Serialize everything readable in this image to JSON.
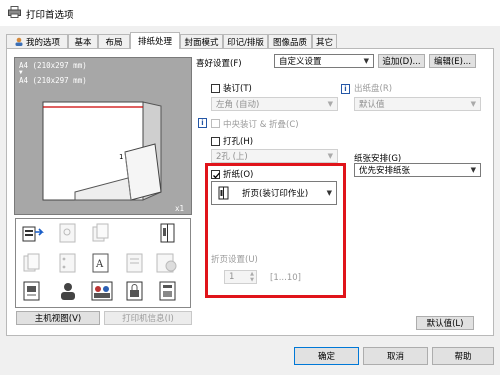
{
  "window": {
    "title": "打印首选项"
  },
  "tabs": [
    {
      "label": "我的选项"
    },
    {
      "label": "基本"
    },
    {
      "label": "布局"
    },
    {
      "label": "排纸处理"
    },
    {
      "label": "封面模式"
    },
    {
      "label": "印记/排版"
    },
    {
      "label": "图像品质"
    },
    {
      "label": "其它"
    }
  ],
  "preview": {
    "paper_line1": "A4 (210x297 mm)",
    "paper_line2": "A4 (210x297 mm)",
    "copies": "x1",
    "page_number": "1"
  },
  "view_buttons": {
    "main_view": "主机视图(V)",
    "printer_info": "打印机信息(I)"
  },
  "favorites": {
    "label": "喜好设置(F)",
    "value": "自定义设置",
    "add": "追加(D)...",
    "edit": "编辑(E)..."
  },
  "staple": {
    "label": "装订(T)",
    "checked": false,
    "value": "左角 (自动)"
  },
  "center_staple": {
    "label": "中央装订 & 折叠(C)",
    "checked": false
  },
  "punch": {
    "label": "打孔(H)",
    "checked": false,
    "value": "2孔 (上)"
  },
  "output_tray": {
    "label": "出纸盘(R)",
    "value": "默认值"
  },
  "fold": {
    "label": "折纸(O)",
    "checked": true,
    "value": "折页(装订印作业)"
  },
  "fold_settings": {
    "label": "折页设置(U)",
    "value": "1",
    "range": "[1...10]"
  },
  "paper_arrangement": {
    "label": "纸张安排(G)",
    "value": "优先安排纸张"
  },
  "default_button": "默认值(L)",
  "footer": {
    "ok": "确定",
    "cancel": "取消",
    "help": "帮助"
  },
  "colors": {
    "accent": "#0078d7",
    "highlight": "#e0141a",
    "preview_bg": "#a7a7a7"
  }
}
